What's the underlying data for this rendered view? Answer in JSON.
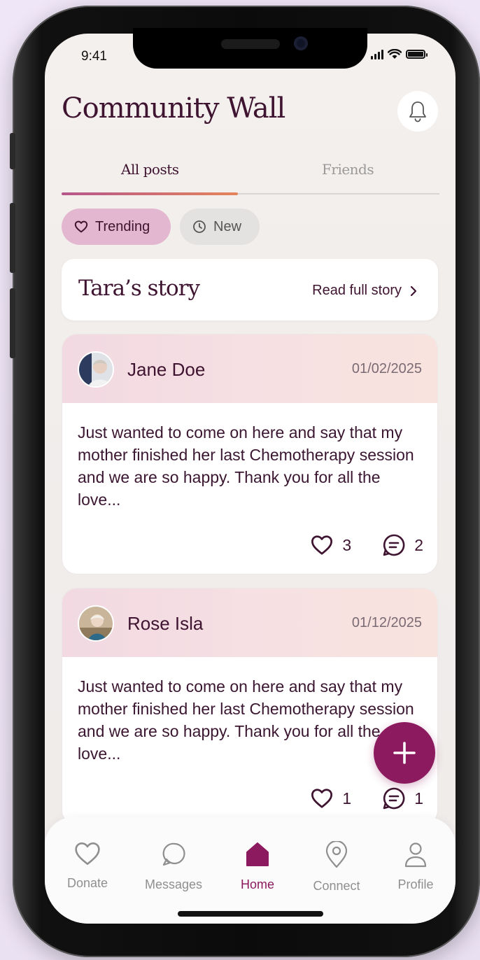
{
  "status": {
    "time": "9:41"
  },
  "header": {
    "title": "Community Wall"
  },
  "tabs": [
    {
      "label": "All posts"
    },
    {
      "label": "Friends"
    }
  ],
  "filters": [
    {
      "label": "Trending"
    },
    {
      "label": "New"
    }
  ],
  "story": {
    "title": "Tara’s story",
    "link": "Read full story"
  },
  "posts": [
    {
      "author": "Jane Doe",
      "date": "01/02/2025",
      "body": "Just wanted to come on here and say that my mother finished her last Chemotherapy session and we are so happy. Thank you for all the love...",
      "likes": "3",
      "comments": "2"
    },
    {
      "author": "Rose Isla",
      "date": "01/12/2025",
      "body": "Just wanted to come on here and say that my mother finished her last Chemotherapy session and we are so happy. Thank you for all the love...",
      "likes": "1",
      "comments": "1"
    }
  ],
  "nav": [
    {
      "label": "Donate",
      "icon": "heart-icon"
    },
    {
      "label": "Messages",
      "icon": "chat-icon"
    },
    {
      "label": "Home",
      "icon": "home-icon"
    },
    {
      "label": "Connect",
      "icon": "location-pin-icon"
    },
    {
      "label": "Profile",
      "icon": "person-icon"
    }
  ],
  "colors": {
    "accent": "#8c1a5e",
    "title": "#3f1430",
    "chip_active": "#e3b7cf"
  }
}
